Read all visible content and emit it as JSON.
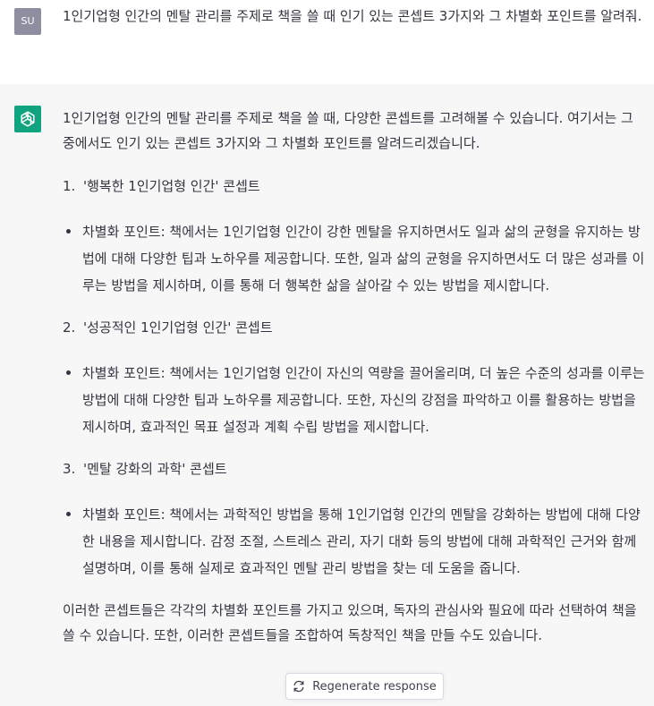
{
  "user_message": {
    "avatar_initials": "SU",
    "text": "1인기업형 인간의 멘탈 관리를 주제로 책을 쓸 때 인기 있는 콘셉트 3가지와 그 차별화 포인트를 알려줘."
  },
  "assistant_message": {
    "avatar_icon": "openai-logo-icon",
    "intro": "1인기업형 인간의 멘탈 관리를 주제로 책을 쓸 때, 다양한 콘셉트를 고려해볼 수 있습니다. 여기서는 그 중에서도 인기 있는 콘셉트 3가지와 그 차별화 포인트를 알려드리겠습니다.",
    "items": [
      {
        "number": "1.",
        "title": "'행복한 1인기업형 인간' 콘셉트",
        "point": "차별화 포인트: 책에서는 1인기업형 인간이 강한 멘탈을 유지하면서도 일과 삶의 균형을 유지하는 방법에 대해 다양한 팁과 노하우를 제공합니다. 또한, 일과 삶의 균형을 유지하면서도 더 많은 성과를 이루는 방법을 제시하며, 이를 통해 더 행복한 삶을 살아갈 수 있는 방법을 제시합니다."
      },
      {
        "number": "2.",
        "title": "'성공적인 1인기업형 인간' 콘셉트",
        "point": "차별화 포인트: 책에서는 1인기업형 인간이 자신의 역량을 끌어올리며, 더 높은 수준의 성과를 이루는 방법에 대해 다양한 팁과 노하우를 제공합니다. 또한, 자신의 강점을 파악하고 이를 활용하는 방법을 제시하며, 효과적인 목표 설정과 계획 수립 방법을 제시합니다."
      },
      {
        "number": "3.",
        "title": "'멘탈 강화의 과학' 콘셉트",
        "point": "차별화 포인트: 책에서는 과학적인 방법을 통해 1인기업형 인간의 멘탈을 강화하는 방법에 대해 다양한 내용을 제시합니다. 감정 조절, 스트레스 관리, 자기 대화 등의 방법에 대해 과학적인 근거와 함께 설명하며, 이를 통해 실제로 효과적인 멘탈 관리 방법을 찾는 데 도움을 줍니다."
      }
    ],
    "outro": "이러한 콘셉트들은 각각의 차별화 포인트를 가지고 있으며, 독자의 관심사와 필요에 따라 선택하여 책을 쓸 수 있습니다. 또한, 이러한 콘셉트들을 조합하여 독창적인 책을 만들 수도 있습니다."
  },
  "regenerate": {
    "label": "Regenerate response",
    "icon": "refresh-icon"
  },
  "colors": {
    "user_avatar": "#8e8ea0",
    "assistant_avatar": "#10a37f",
    "assistant_background": "#f7f7f8",
    "text": "#343541"
  }
}
